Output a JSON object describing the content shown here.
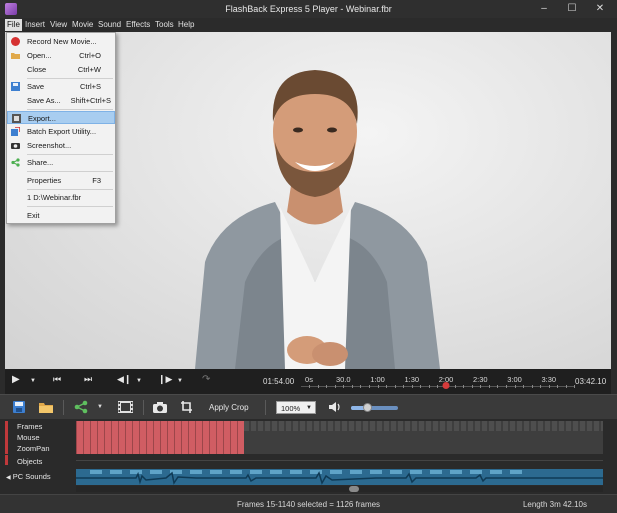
{
  "window": {
    "title": "FlashBack Express 5 Player - Webinar.fbr",
    "minimize": "–",
    "maximize": "☐",
    "close": "✕"
  },
  "menubar": {
    "items": [
      {
        "label": "File"
      },
      {
        "label": "Insert"
      },
      {
        "label": "View"
      },
      {
        "label": "Movie"
      },
      {
        "label": "Sound"
      },
      {
        "label": "Effects"
      },
      {
        "label": "Tools"
      },
      {
        "label": "Help"
      }
    ]
  },
  "file_menu": {
    "items": [
      {
        "label": "Record New Movie...",
        "shortcut": ""
      },
      {
        "label": "Open...",
        "shortcut": "Ctrl+O"
      },
      {
        "label": "Close",
        "shortcut": "Ctrl+W"
      },
      {
        "label": "Save",
        "shortcut": "Ctrl+S"
      },
      {
        "label": "Save As...",
        "shortcut": "Shift+Ctrl+S"
      },
      {
        "label": "Export...",
        "shortcut": ""
      },
      {
        "label": "Batch Export Utility...",
        "shortcut": ""
      },
      {
        "label": "Screenshot...",
        "shortcut": ""
      },
      {
        "label": "Share...",
        "shortcut": ""
      },
      {
        "label": "Properties",
        "shortcut": "F3"
      },
      {
        "label": "1 D:\\Webinar.fbr",
        "shortcut": ""
      },
      {
        "label": "Exit",
        "shortcut": ""
      }
    ],
    "highlighted": "Export..."
  },
  "player": {
    "current_time": "01:54.00",
    "total_time": "03:42.10",
    "ruler_labels": [
      "0s",
      "30.0",
      "1:00",
      "1:30",
      "2:00",
      "2:30",
      "3:00",
      "3:30"
    ]
  },
  "toolbar": {
    "apply_crop_label": "Apply Crop",
    "zoom_value": "100%",
    "volume_level": 0.35
  },
  "tracks": {
    "frames_label": "Frames",
    "mouse_label": "Mouse",
    "zoompan_label": "ZoomPan",
    "objects_label": "Objects",
    "pcsounds_label": "PC Sounds"
  },
  "status": {
    "frames_text": "Frames 15-1140 selected = 1126 frames",
    "length_text": "Length 3m 42.10s"
  },
  "colors": {
    "record_red": "#d63232",
    "selection_red": "#d05d63",
    "menu_highlight": "#a8cdf0",
    "sound_blue": "#2c6a90"
  }
}
